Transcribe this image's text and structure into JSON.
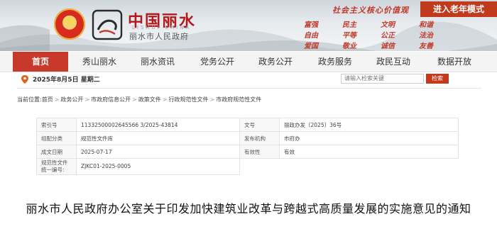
{
  "header": {
    "site_name_cn": "中国丽水",
    "site_name_en": "LISHUI CHINA",
    "site_subtitle": "丽水市人民政府",
    "slogan": "社会主义核心价值观",
    "elder_mode": "进入老年模式",
    "core_values": [
      "富强",
      "民主",
      "文明",
      "和谐",
      "自由",
      "平等",
      "公正",
      "法治",
      "爱国",
      "敬业",
      "诚信",
      "友善"
    ],
    "colors": {
      "brand_red": "#c23a1d",
      "nav_active": "#c8392b"
    }
  },
  "nav": {
    "items": [
      "首页",
      "秀山丽水",
      "丽水资讯",
      "党务公开",
      "政务公开",
      "政务服务",
      "政民互动",
      "数据开放"
    ],
    "active_index": 0
  },
  "infobar": {
    "date": "2025年8月5日 星期二",
    "search_placeholder": "请输入检索关键",
    "search_button": "检索"
  },
  "breadcrumb": {
    "label": "当前位置:",
    "items": [
      "首页",
      "政务公开",
      "市政府信息公开",
      "政策文件",
      "行政规范性文件",
      "市政府规范性文件"
    ]
  },
  "meta": {
    "rows": [
      {
        "k1": "索引号",
        "v1": "11332500002645566 3/2025-43814",
        "k2": "文号",
        "v2": "丽政办发〔2025〕36号"
      },
      {
        "k1": "组配分类",
        "v1": "规范性文件库",
        "k2": "发布机构",
        "v2": "市府办"
      },
      {
        "k1": "成文日期",
        "v1": "2025-07-17",
        "k2": "有效性",
        "v2": "有效"
      },
      {
        "k1": "规范性文件统一编号:",
        "v1": "ZJKC01-2025-0005",
        "k2": "",
        "v2": ""
      }
    ]
  },
  "document": {
    "title": "丽水市人民政府办公室关于印发加快建筑业改革与跨越式高质量发展的实施意见的通知"
  }
}
